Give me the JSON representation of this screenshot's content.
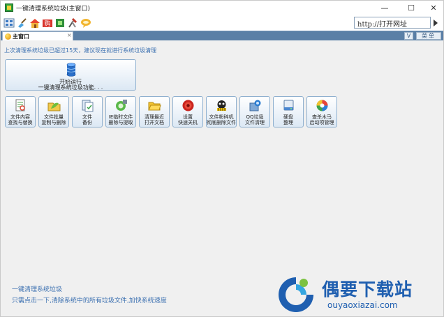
{
  "window": {
    "title": "一键清理系统垃圾(主窗口)",
    "controls": {
      "minimize": "—",
      "maximize": "☐",
      "close": "✕"
    }
  },
  "toolbar": {
    "icons": [
      "grid-icon",
      "broom-icon",
      "home-icon",
      "shop-icon",
      "chip-icon",
      "tools-icon",
      "chat-icon"
    ],
    "url_text": "http://打开网址"
  },
  "tabs": {
    "active_label": "主窗口",
    "close_glyph": "×",
    "v_button": "V",
    "menu_button": "菜单"
  },
  "main": {
    "notice": "上次清理系统垃圾已超过15天，建议现在就进行系统垃圾清理",
    "big_button": {
      "line1": "开始运行",
      "line2": "一键清理系统垃圾功能. . ."
    },
    "tools": [
      {
        "name": "file-search-replace",
        "icon": "search-doc-icon",
        "line1": "文件内容",
        "line2": "查找与替换"
      },
      {
        "name": "file-batch-copy-delete",
        "icon": "folder-leaf-icon",
        "line1": "文件批量",
        "line2": "复制与删除"
      },
      {
        "name": "file-backup",
        "icon": "backup-doc-icon",
        "line1": "文件",
        "line2": "备份"
      },
      {
        "name": "ie-temp-files",
        "icon": "ie-cleanup-icon",
        "line1": "IE临时文件",
        "line2": "删除与提取"
      },
      {
        "name": "clean-recent",
        "icon": "folder-open-icon",
        "line1": "清理最近",
        "line2": "打开文档"
      },
      {
        "name": "quick-shutdown",
        "icon": "target-icon",
        "line1": "设置",
        "line2": "快速关机"
      },
      {
        "name": "file-shredder",
        "icon": "shredder-icon",
        "line1": "文件粉碎机",
        "line2": "彻底删除文件"
      },
      {
        "name": "qq-garbage",
        "icon": "qq-cleanup-icon",
        "line1": "QQ垃圾",
        "line2": "文件清理"
      },
      {
        "name": "disk-defrag",
        "icon": "disk-icon",
        "line1": "硬盘",
        "line2": "整理"
      },
      {
        "name": "trojan-startup",
        "icon": "shield-ball-icon",
        "line1": "查杀木马",
        "line2": "启动项管理"
      }
    ],
    "footer_title": "一键清理系统垃圾",
    "footer_desc": "只需点击一下,清除系统中的所有垃圾文件,加快系统速度"
  },
  "watermark": {
    "cn": "偶要下载站",
    "en": "ouyaoxiazai.com"
  },
  "colors": {
    "tabbar": "#5a7fa6",
    "link_text": "#3a6fb0",
    "watermark": "#1f5fb0",
    "button_border": "#8fb0cf"
  }
}
